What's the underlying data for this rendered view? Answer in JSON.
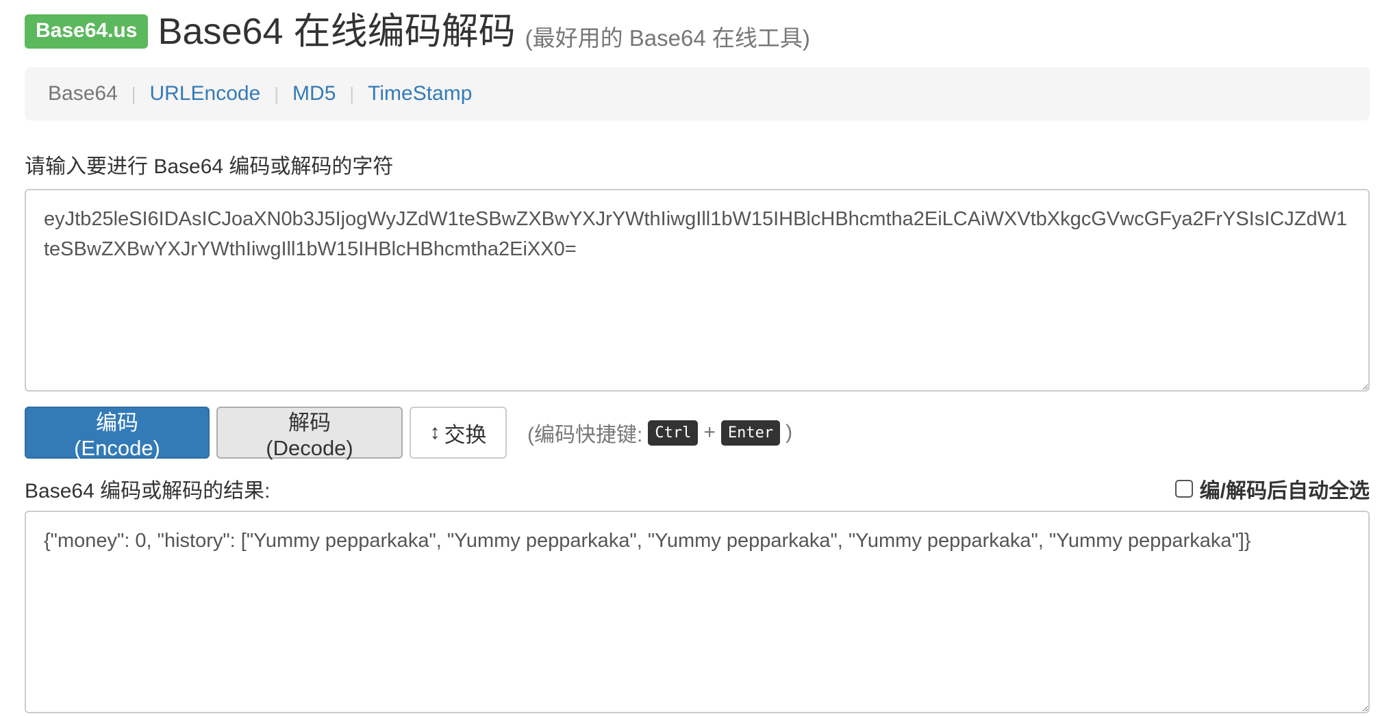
{
  "header": {
    "brand": "Base64.us",
    "title": "Base64 在线编码解码",
    "subtitle": "(最好用的 Base64 在线工具)"
  },
  "nav": {
    "items": [
      {
        "label": "Base64",
        "active": true
      },
      {
        "label": "URLEncode",
        "active": false
      },
      {
        "label": "MD5",
        "active": false
      },
      {
        "label": "TimeStamp",
        "active": false
      }
    ],
    "separator": "|"
  },
  "input": {
    "label": "请输入要进行 Base64 编码或解码的字符",
    "value": "eyJtb25leSI6IDAsICJoaXN0b3J5IjogWyJZdW1teSBwZXBwYXJrYWthIiwgIll1bW15IHBlcHBhcmtha2EiLCAiWXVtbXkgcGVwcGFya2FrYSIsICJZdW1teSBwZXBwYXJrYWthIiwgIll1bW15IHBlcHBhcmtha2EiXX0="
  },
  "buttons": {
    "encode": "编码 (Encode)",
    "decode": "解码 (Decode)",
    "swap_icon": "↕",
    "swap": "交换"
  },
  "shortcut": {
    "prefix": "(编码快捷键:",
    "key1": "Ctrl",
    "plus": "+",
    "key2": "Enter",
    "suffix": ")"
  },
  "result": {
    "label": "Base64 编码或解码的结果:",
    "auto_select_label": "编/解码后自动全选",
    "auto_select_checked": false,
    "value": "{\"money\": 0, \"history\": [\"Yummy pepparkaka\", \"Yummy pepparkaka\", \"Yummy pepparkaka\", \"Yummy pepparkaka\", \"Yummy pepparkaka\"]}"
  },
  "colors": {
    "brand": "#5cb85c",
    "primary": "#337ab7",
    "link": "#337ab7"
  }
}
